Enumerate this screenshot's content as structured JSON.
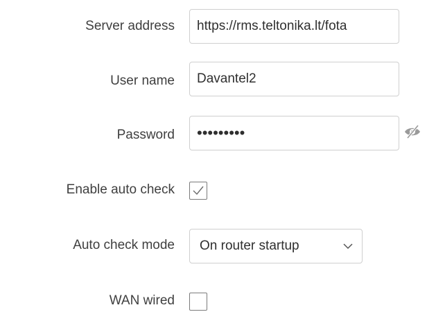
{
  "form": {
    "server_address": {
      "label": "Server address",
      "value": "https://rms.teltonika.lt/fota"
    },
    "user_name": {
      "label": "User name",
      "value": "Davantel2"
    },
    "password": {
      "label": "Password",
      "masked_value": "•••••••••",
      "toggle_icon": "eye-slash-icon"
    },
    "enable_auto_check": {
      "label": "Enable auto check",
      "checked": true
    },
    "auto_check_mode": {
      "label": "Auto check mode",
      "selected": "On router startup",
      "dropdown_icon": "chevron-down-icon"
    },
    "wan_wired": {
      "label": "WAN wired",
      "checked": false
    }
  }
}
